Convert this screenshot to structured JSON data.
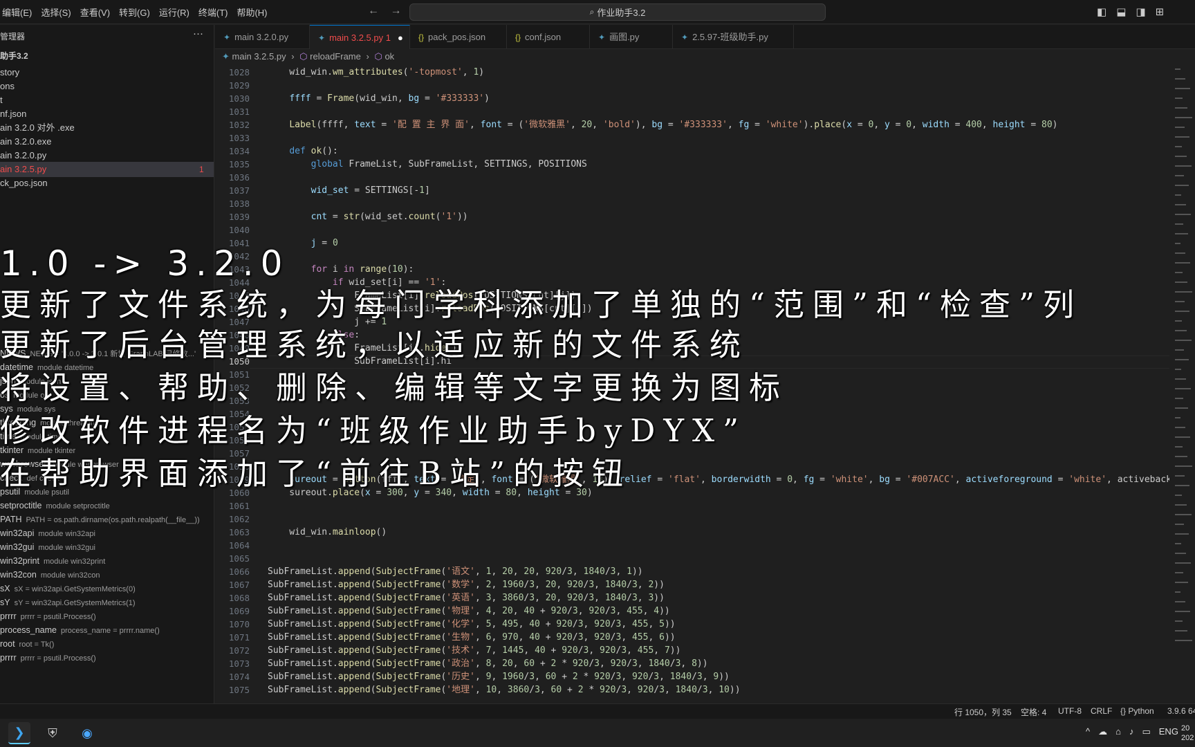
{
  "menu": [
    "编辑(E)",
    "选择(S)",
    "查看(V)",
    "转到(G)",
    "运行(R)",
    "终端(T)",
    "帮助(H)"
  ],
  "nav": {
    "back": "←",
    "forward": "→"
  },
  "command_center": {
    "label": "作业助手3.2"
  },
  "sidebar": {
    "title": "管理器",
    "more": "···",
    "folder": "助手3.2",
    "files": [
      {
        "name": "story"
      },
      {
        "name": "ons"
      },
      {
        "name": "t"
      },
      {
        "name": "nf.json"
      },
      {
        "name": "ain 3.2.0 对外 .exe"
      },
      {
        "name": "ain 3.2.0.exe"
      },
      {
        "name": "ain 3.2.0.py"
      },
      {
        "name": "ain 3.2.5.py",
        "badge": "1"
      },
      {
        "name": "ck_pos.json"
      }
    ],
    "outline": [
      {
        "name": "NEWS",
        "detail": "NEWS = '3.0.0 -> 3.0.1 新增 GraphLAB 已修改...'"
      },
      {
        "name": "datetime",
        "detail": "module datetime"
      },
      {
        "name": "json",
        "detail": "module json"
      },
      {
        "name": "os",
        "detail": "module os"
      },
      {
        "name": "sys",
        "detail": "module sys"
      },
      {
        "name": "threading",
        "detail": "module threading"
      },
      {
        "name": "time",
        "detail": "module time"
      },
      {
        "name": "tkinter",
        "detail": "module tkinter"
      },
      {
        "name": "webbrowser",
        "detail": "module webbrowser"
      },
      {
        "name": "check",
        "detail": "def check"
      },
      {
        "name": "psutil",
        "detail": "module psutil"
      },
      {
        "name": "setproctitle",
        "detail": "module setproctitle"
      },
      {
        "name": "PATH",
        "detail": "PATH = os.path.dirname(os.path.realpath(__file__))"
      },
      {
        "name": "win32api",
        "detail": "module win32api"
      },
      {
        "name": "win32gui",
        "detail": "module win32gui"
      },
      {
        "name": "win32print",
        "detail": "module win32print"
      },
      {
        "name": "win32con",
        "detail": "module win32con"
      },
      {
        "name": "sX",
        "detail": "sX = win32api.GetSystemMetrics(0)"
      },
      {
        "name": "sY",
        "detail": "sY = win32api.GetSystemMetrics(1)"
      },
      {
        "name": "prrrr",
        "detail": "prrrr = psutil.Process()"
      },
      {
        "name": "process_name",
        "detail": "process_name = prrrr.name()"
      },
      {
        "name": "root",
        "detail": "root = Tk()"
      },
      {
        "name": "prrrr",
        "detail": "prrrr = psutil.Process()"
      }
    ]
  },
  "tabs": [
    {
      "label": "main 3.2.0.py",
      "kind": "py"
    },
    {
      "label": "main 3.2.5.py 1",
      "kind": "py",
      "active": true,
      "modified": "●"
    },
    {
      "label": "pack_pos.json",
      "kind": "json"
    },
    {
      "label": "conf.json",
      "kind": "json"
    },
    {
      "label": "画图.py",
      "kind": "py"
    },
    {
      "label": "2.5.97-班级助手.py",
      "kind": "py"
    }
  ],
  "breadcrumb": [
    "main 3.2.5.py",
    "reloadFrame",
    "ok"
  ],
  "code_lines": [
    {
      "n": "1028",
      "t": "    wid_win.wm_attributes('-topmost', 1)"
    },
    {
      "n": "1029",
      "t": ""
    },
    {
      "n": "1030",
      "t": "    ffff = Frame(wid_win, bg = '#333333')"
    },
    {
      "n": "1031",
      "t": ""
    },
    {
      "n": "1032",
      "t": "    Label(ffff, text = '配 置 主 界 面', font = ('微软雅黑', 20, 'bold'), bg = '#333333', fg = 'white').place(x = 0, y = 0, width = 400, height = 80)"
    },
    {
      "n": "1033",
      "t": ""
    },
    {
      "n": "1034",
      "t": "    def ok():"
    },
    {
      "n": "1035",
      "t": "        global FrameList, SubFrameList, SETTINGS, POSITIONS"
    },
    {
      "n": "1036",
      "t": ""
    },
    {
      "n": "1037",
      "t": "        wid_set = SETTINGS[-1]"
    },
    {
      "n": "1038",
      "t": ""
    },
    {
      "n": "1039",
      "t": "        cnt = str(wid_set.count('1'))"
    },
    {
      "n": "1040",
      "t": ""
    },
    {
      "n": "1041",
      "t": "        j = 0"
    },
    {
      "n": "1042",
      "t": ""
    },
    {
      "n": "1043",
      "t": "        for i in range(10):"
    },
    {
      "n": "1044",
      "t": "            if wid_set[i] == '1':"
    },
    {
      "n": "1045",
      "t": "                FrameList[i].reloadPos(POSITIONS[cnt][j])"
    },
    {
      "n": "1046",
      "t": "                SubFrameList[i].reloadPos(POSITIONS[cnt][j])"
    },
    {
      "n": "1047",
      "t": "                j += 1"
    },
    {
      "n": "1048",
      "t": "            else:"
    },
    {
      "n": "1049",
      "t": "                FrameList[i].hide()"
    },
    {
      "n": "1050",
      "t": "                SubFrameList[i].hi"
    },
    {
      "n": "1051",
      "t": ""
    },
    {
      "n": "1052",
      "t": ""
    },
    {
      "n": "1053",
      "t": ""
    },
    {
      "n": "1054",
      "t": ""
    },
    {
      "n": "1055",
      "t": ""
    },
    {
      "n": "1056",
      "t": ""
    },
    {
      "n": "1057",
      "t": ""
    },
    {
      "n": "1058",
      "t": ""
    },
    {
      "n": "1059",
      "t": "    sureout = Button(ffff, text = '确定', font = ('微软雅黑', 13), relief = 'flat', borderwidth = 0, fg = 'white', bg = '#007ACC', activeforeground = 'white', activebackgr"
    },
    {
      "n": "1060",
      "t": "    sureout.place(x = 300, y = 340, width = 80, height = 30)"
    },
    {
      "n": "1061",
      "t": ""
    },
    {
      "n": "1062",
      "t": ""
    },
    {
      "n": "1063",
      "t": "    wid_win.mainloop()"
    },
    {
      "n": "1064",
      "t": ""
    },
    {
      "n": "1065",
      "t": ""
    },
    {
      "n": "1066",
      "t": "SubFrameList.append(SubjectFrame('语文', 1, 20, 20, 920/3, 1840/3, 1))"
    },
    {
      "n": "1067",
      "t": "SubFrameList.append(SubjectFrame('数学', 2, 1960/3, 20, 920/3, 1840/3, 2))"
    },
    {
      "n": "1068",
      "t": "SubFrameList.append(SubjectFrame('英语', 3, 3860/3, 20, 920/3, 1840/3, 3))"
    },
    {
      "n": "1069",
      "t": "SubFrameList.append(SubjectFrame('物理', 4, 20, 40 + 920/3, 920/3, 455, 4))"
    },
    {
      "n": "1070",
      "t": "SubFrameList.append(SubjectFrame('化学', 5, 495, 40 + 920/3, 920/3, 455, 5))"
    },
    {
      "n": "1071",
      "t": "SubFrameList.append(SubjectFrame('生物', 6, 970, 40 + 920/3, 920/3, 455, 6))"
    },
    {
      "n": "1072",
      "t": "SubFrameList.append(SubjectFrame('技术', 7, 1445, 40 + 920/3, 920/3, 455, 7))"
    },
    {
      "n": "1073",
      "t": "SubFrameList.append(SubjectFrame('政治', 8, 20, 60 + 2 * 920/3, 920/3, 1840/3, 8))"
    },
    {
      "n": "1074",
      "t": "SubFrameList.append(SubjectFrame('历史', 9, 1960/3, 60 + 2 * 920/3, 920/3, 1840/3, 9))"
    },
    {
      "n": "1075",
      "t": "SubFrameList.append(SubjectFrame('地理', 10, 3860/3, 60 + 2 * 920/3, 920/3, 1840/3, 10))"
    }
  ],
  "current_line": "1050",
  "overlay": {
    "version": "1.0 -> 3.2.0",
    "lines": [
      "更新了文件系统，为每门学科添加了单独的“范围”和“检查”列",
      "更新了后台管理系统，以适应新的文件系统",
      "将设置、帮助、删除、编辑等文字更换为图标",
      "修改软件进程名为“班级作业助手byDYX”",
      "在帮助界面添加了“前往B站”的按钮"
    ]
  },
  "statusbar": {
    "position": "行 1050，列 35",
    "spaces": "空格: 4",
    "encoding": "UTF-8",
    "eol": "CRLF",
    "language": "{} Python",
    "interpreter": "3.9.6 64"
  },
  "taskbar": {
    "lang": "ENG",
    "clock": "20",
    "clock2": "202"
  },
  "colors": {
    "keyword": "#569cd6",
    "control": "#c586c0",
    "string": "#ce9178",
    "number": "#b5cea8",
    "function": "#dcdcaa",
    "param": "#9cdcfe",
    "error": "#f14c4c"
  }
}
